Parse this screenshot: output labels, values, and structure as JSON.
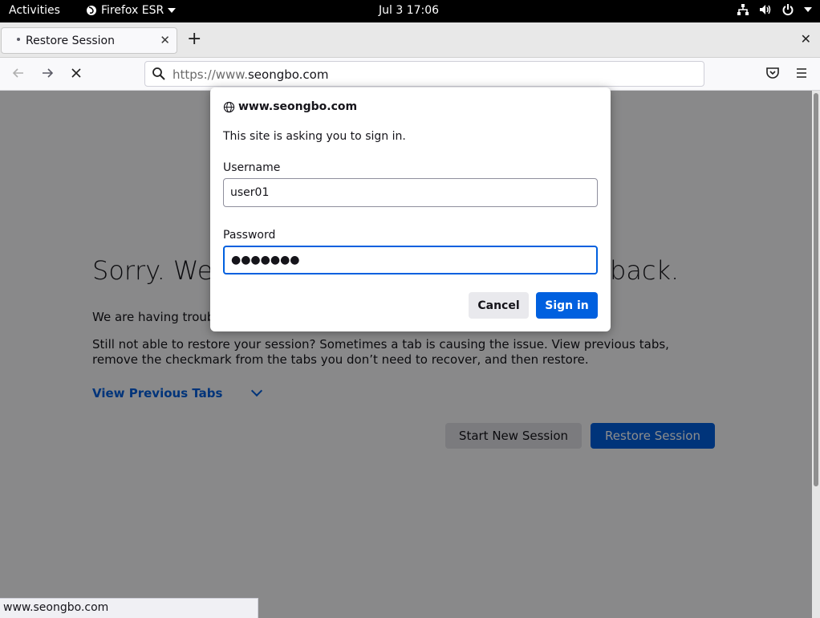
{
  "topbar": {
    "activities": "Activities",
    "app_name": "Firefox ESR",
    "clock": "Jul 3  17:06",
    "icons": [
      "network-icon",
      "volume-icon",
      "power-icon"
    ]
  },
  "tabs": [
    {
      "label": "Restore Session"
    }
  ],
  "navbar": {
    "url_scheme": "https://www.",
    "url_host": "seongbo.com"
  },
  "page": {
    "heading": "Sorry. We’r",
    "heading_end": "back.",
    "paragraph1": "We are having trouble",
    "paragraph2": "Still not able to restore your session? Sometimes a tab is causing the issue. View previous tabs, remove the checkmark from the tabs you don’t need to recover, and then restore.",
    "view_previous": "View Previous Tabs",
    "start_new": "Start New Session",
    "restore": "Restore Session"
  },
  "statusbar": "www.seongbo.com",
  "dialog": {
    "origin": "www.seongbo.com",
    "message": "This site is asking you to sign in.",
    "username_label": "Username",
    "username_value": "user01",
    "password_label": "Password",
    "password_value": "●●●●●●●",
    "cancel": "Cancel",
    "signin": "Sign in"
  },
  "colors": {
    "accent": "#0060df",
    "topbar": "#000000"
  }
}
